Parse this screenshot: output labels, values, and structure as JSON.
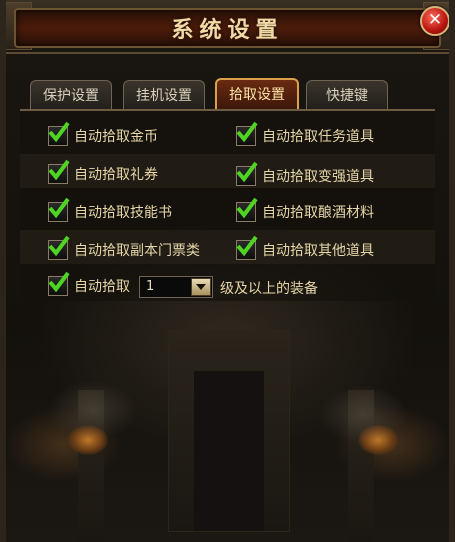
{
  "window": {
    "title": "系统设置"
  },
  "tabs": [
    {
      "label": "保护设置",
      "active": false
    },
    {
      "label": "挂机设置",
      "active": false
    },
    {
      "label": "拾取设置",
      "active": true
    },
    {
      "label": "快捷键",
      "active": false
    }
  ],
  "options": [
    {
      "label": "自动拾取金币",
      "checked": true
    },
    {
      "label": "自动拾取任务道具",
      "checked": true
    },
    {
      "label": "自动拾取礼券",
      "checked": true
    },
    {
      "label": "自动拾取变强道具",
      "checked": true
    },
    {
      "label": "自动拾取技能书",
      "checked": true
    },
    {
      "label": "自动拾取酿酒材料",
      "checked": true
    },
    {
      "label": "自动拾取副本门票类",
      "checked": true
    },
    {
      "label": "自动拾取其他道具",
      "checked": true
    }
  ],
  "equip_pickup": {
    "label": "自动拾取",
    "checked": true,
    "level_value": "1",
    "suffix": "级及以上的装备"
  },
  "colors": {
    "check": "#4fd423",
    "text": "#e6d6a8",
    "active_tab": "#6a2a10"
  }
}
